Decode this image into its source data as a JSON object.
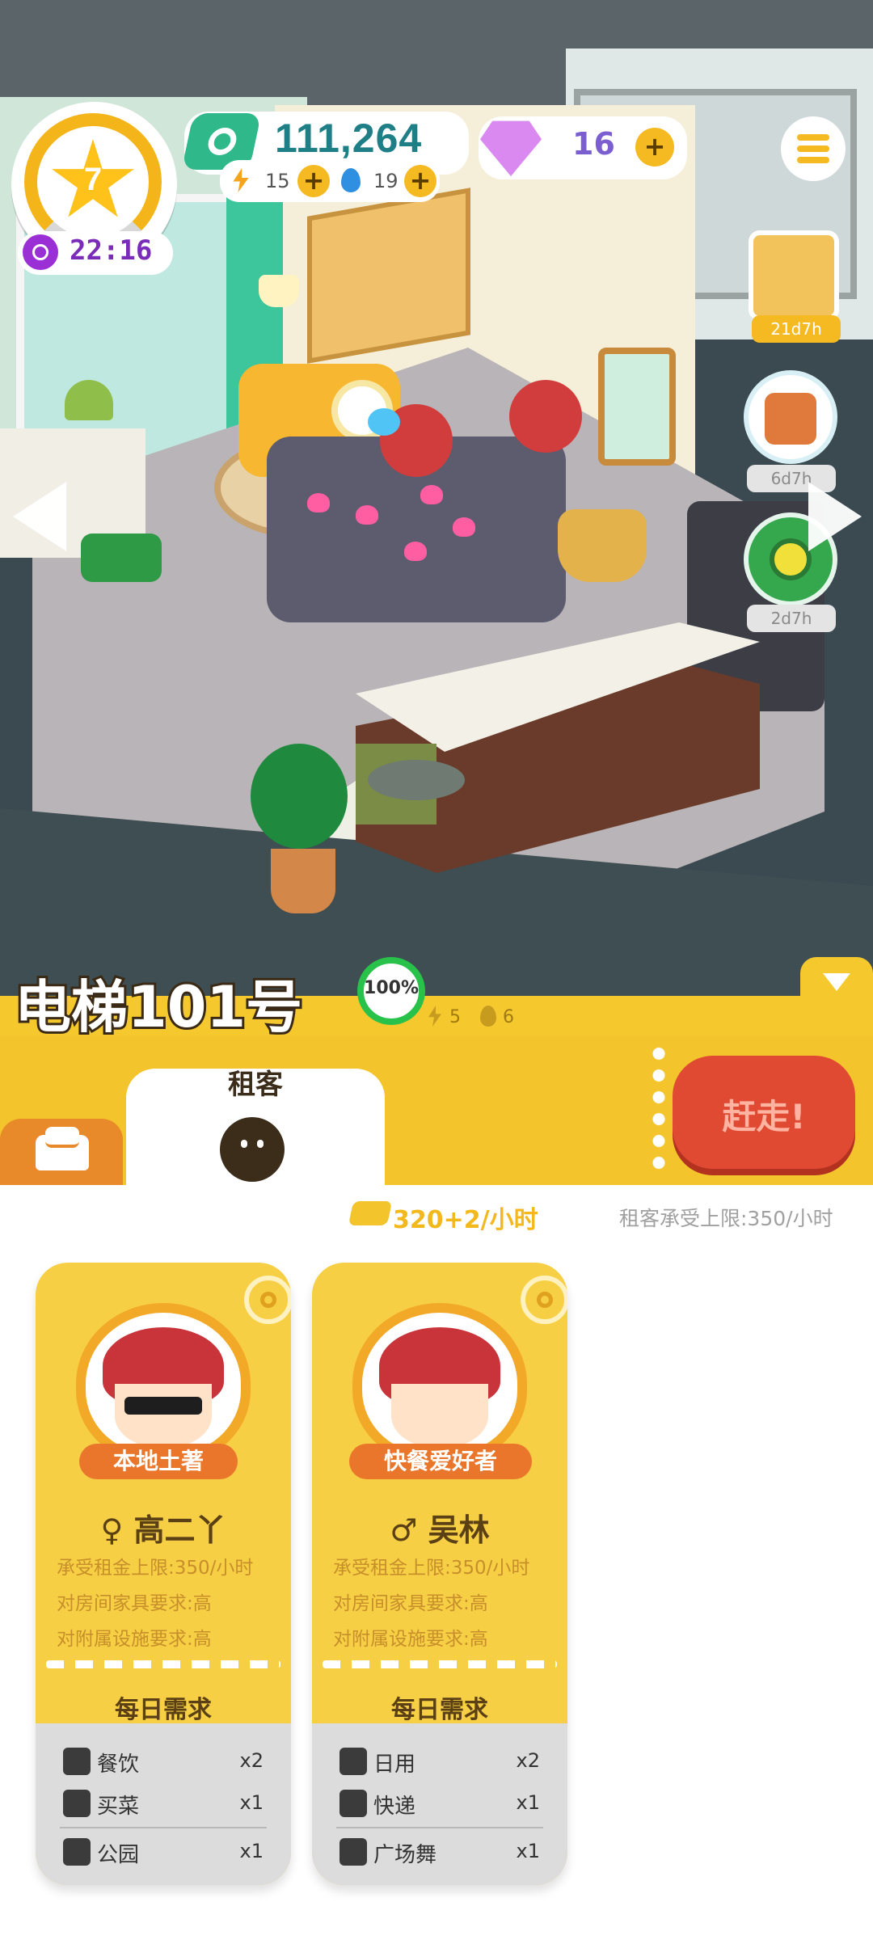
{
  "hud": {
    "level": "7",
    "timer": "22:16",
    "money": "111,264",
    "energy": "15",
    "water": "19",
    "gems": "16",
    "plus": "+"
  },
  "side_items": [
    {
      "tag": "21d7h"
    },
    {
      "tag": "6d7h"
    },
    {
      "tag": "2d7h"
    }
  ],
  "room": {
    "name": "电梯101号",
    "progress": "100%",
    "energy": "5",
    "water": "6"
  },
  "tabs": {
    "tenants_label": "租客",
    "evict_label": "赶走!"
  },
  "income": {
    "rate": "320+2/小时",
    "cap": "租客承受上限:350/小时"
  },
  "tenants": [
    {
      "trait": "本地土著",
      "gender_symbol": "♀",
      "name": "高二丫",
      "rent_cap": "承受租金上限:350/小时",
      "furniture_req": "对房间家具要求:高",
      "facility_req": "对附属设施要求:高",
      "needs_title": "每日需求",
      "needs": [
        {
          "icon": "utensils-icon",
          "label": "餐饮",
          "mult": "x2"
        },
        {
          "icon": "basket-icon",
          "label": "买菜",
          "mult": "x1"
        },
        {
          "icon": "park-icon",
          "label": "公园",
          "mult": "x1"
        }
      ]
    },
    {
      "trait": "快餐爱好者",
      "gender_symbol": "♂",
      "name": "吴林",
      "rent_cap": "承受租金上限:350/小时",
      "furniture_req": "对房间家具要求:高",
      "facility_req": "对附属设施要求:高",
      "needs_title": "每日需求",
      "needs": [
        {
          "icon": "toilet-paper-icon",
          "label": "日用",
          "mult": "x2"
        },
        {
          "icon": "package-icon",
          "label": "快递",
          "mult": "x1"
        },
        {
          "icon": "music-note-icon",
          "label": "广场舞",
          "mult": "x1"
        }
      ]
    }
  ],
  "colors": {
    "accent_yellow": "#f3c42b",
    "evict_red": "#e04a32",
    "money_teal": "#2fb88a"
  }
}
